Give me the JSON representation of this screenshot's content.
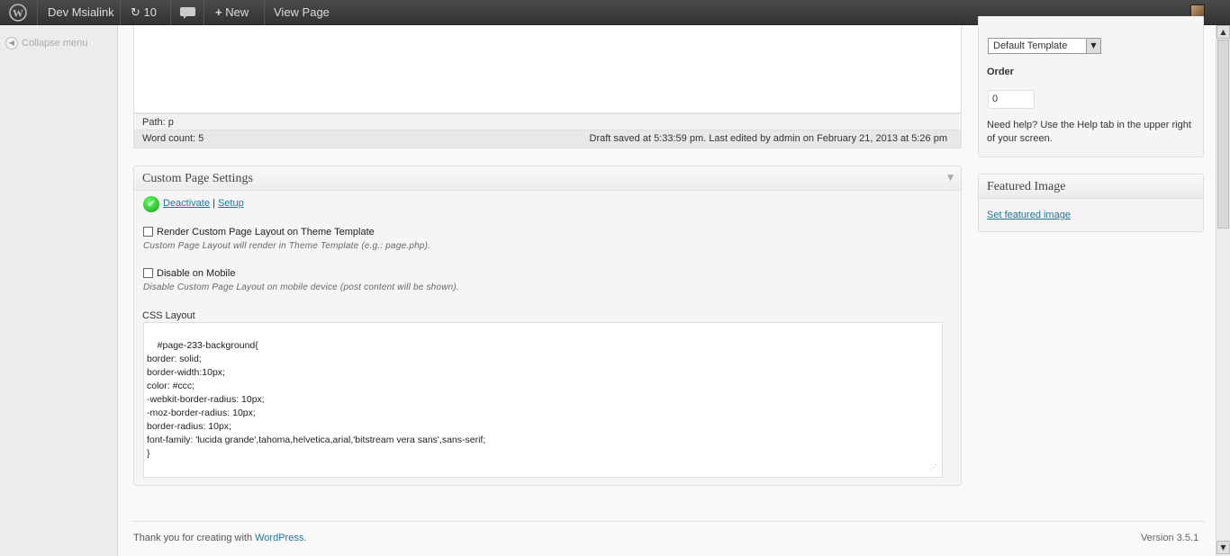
{
  "admin_bar": {
    "site_name": "Dev Msialink",
    "updates_count": "10",
    "new_label": "New",
    "view_page_label": "View Page"
  },
  "sidebar": {
    "collapse_label": "Collapse menu"
  },
  "editor": {
    "path_text": "Path: p",
    "word_count": "Word count: 5",
    "draft_status": "Draft saved at 5:33:59 pm. Last edited by admin on February 21, 2013 at 5:26 pm"
  },
  "custom_page_settings": {
    "title": "Custom Page Settings",
    "deactivate_label": "Deactivate",
    "separator": "|",
    "setup_label": "Setup",
    "render_label": "Render Custom Page Layout on Theme Template",
    "render_checked": false,
    "render_hint": "Custom Page Layout will render in Theme Template (e.g.: page.php).",
    "mobile_label": "Disable on Mobile",
    "mobile_checked": false,
    "mobile_hint": "Disable Custom Page Layout on mobile device (post content will be shown).",
    "css_label": "CSS Layout",
    "css_value": "#page-233-background{\nborder: solid;\nborder-width:10px;\ncolor: #ccc;\n-webkit-border-radius: 10px;\n-moz-border-radius: 10px;\nborder-radius: 10px;\nfont-family: 'lucida grande',tahoma,helvetica,arial,'bitstream vera sans',sans-serif;\n}"
  },
  "page_attributes": {
    "template_value": "Default Template",
    "order_label": "Order",
    "order_value": "0",
    "help_text": "Need help? Use the Help tab in the upper right of your screen."
  },
  "featured_image": {
    "title": "Featured Image",
    "link_label": "Set featured image"
  },
  "footer": {
    "thanks_prefix": "Thank you for creating with ",
    "wordpress_link": "WordPress",
    "thanks_suffix": ".",
    "version": "Version 3.5.1"
  },
  "colors": {
    "admin_bar_bg": "#333333",
    "link": "#21759b",
    "check_green": "#1a9a1a"
  },
  "icons": [
    "wordpress-logo-icon",
    "refresh-icon",
    "comment-bubble-icon",
    "plus-icon",
    "collapse-arrow-icon",
    "checkmark-icon",
    "dropdown-arrow-icon",
    "resize-grip-icon"
  ]
}
